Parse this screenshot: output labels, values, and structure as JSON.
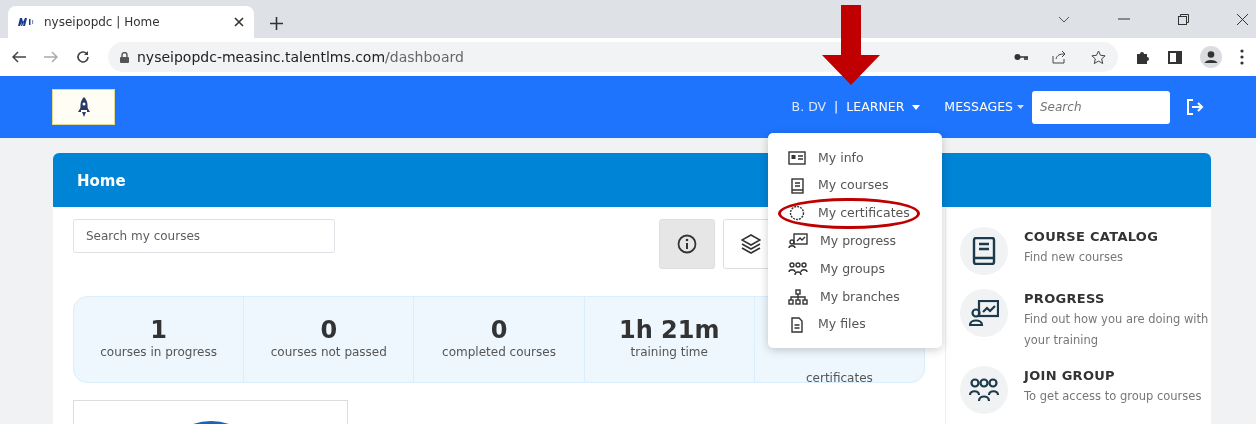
{
  "browser": {
    "tab_title": "nyseipopdc | Home",
    "url_host": "nyseipopdc-measinc.talentlms.com",
    "url_path": "/dashboard"
  },
  "navbar": {
    "user": "B. DV",
    "separator": "|",
    "role": "LEARNER",
    "user_menu_expanded": true,
    "messages": "MESSAGES",
    "search_placeholder": "Search"
  },
  "user_menu": [
    {
      "kind": "info",
      "label": "My info",
      "highlighted": false
    },
    {
      "kind": "courses",
      "label": "My courses",
      "highlighted": false
    },
    {
      "kind": "certificates",
      "label": "My certificates",
      "highlighted": true
    },
    {
      "kind": "progress",
      "label": "My progress",
      "highlighted": false
    },
    {
      "kind": "groups",
      "label": "My groups",
      "highlighted": false
    },
    {
      "kind": "branches",
      "label": "My branches",
      "highlighted": false
    },
    {
      "kind": "files",
      "label": "My files",
      "highlighted": false
    }
  ],
  "home": {
    "title": "Home",
    "search_placeholder": "Search my courses",
    "view_buttons": [
      {
        "kind": "info",
        "selected": true
      },
      {
        "kind": "layers",
        "selected": false
      }
    ],
    "stats": [
      {
        "value": "1",
        "label": "courses in progress"
      },
      {
        "value": "0",
        "label": "courses not passed"
      },
      {
        "value": "0",
        "label": "completed courses"
      },
      {
        "value": "1h 21m",
        "label": "training time"
      },
      {
        "label": "certificates"
      }
    ]
  },
  "side_links": [
    {
      "kind": "catalog",
      "title": "COURSE CATALOG",
      "text": "Find new courses"
    },
    {
      "kind": "progress",
      "title": "PROGRESS",
      "text": "Find out how you are doing with your training"
    },
    {
      "kind": "groups",
      "title": "JOIN GROUP",
      "text": "To get access to group courses"
    }
  ]
}
